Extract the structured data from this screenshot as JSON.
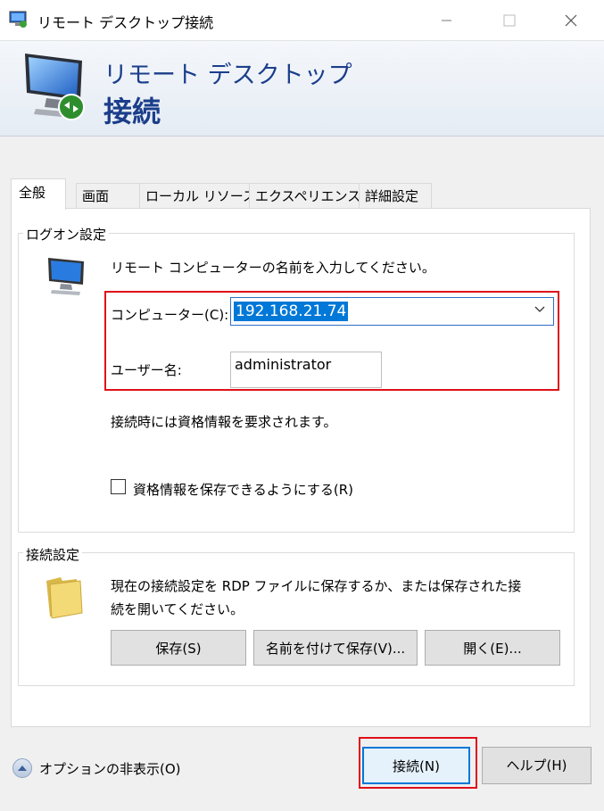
{
  "window": {
    "title": "リモート デスクトップ接続",
    "controls": {
      "minimize_icon": "minimize-icon",
      "maximize_icon": "maximize-icon",
      "close_icon": "close-icon"
    }
  },
  "banner": {
    "line1": "リモート デスクトップ",
    "line2": "接続",
    "icon": "remote-desktop-monitor-icon"
  },
  "tabs": [
    {
      "label": "全般",
      "active": true
    },
    {
      "label": "画面",
      "active": false
    },
    {
      "label": "ローカル リソース",
      "active": false
    },
    {
      "label": "エクスペリエンス",
      "active": false
    },
    {
      "label": "詳細設定",
      "active": false
    }
  ],
  "logon": {
    "group_label": "ログオン設定",
    "instruction": "リモート コンピューターの名前を入力してください。",
    "computer_label": "コンピューター(C):",
    "computer_value": "192.168.21.74",
    "username_label": "ユーザー名:",
    "username_value": "administrator",
    "credential_note": "接続時には資格情報を要求されます。",
    "save_credentials_label": "資格情報を保存できるようにする(R)",
    "save_credentials_checked": false
  },
  "connection": {
    "group_label": "接続設定",
    "description": "現在の接続設定を RDP ファイルに保存するか、または保存された接続を開いてください。",
    "description_line1": "現在の接続設定を RDP ファイルに保存するか、または保存された接",
    "description_line2": "続を開いてください。",
    "save_label": "保存(S)",
    "save_as_label": "名前を付けて保存(V)...",
    "open_label": "開く(E)..."
  },
  "footer": {
    "options_label": "オプションの非表示(O)",
    "connect_label": "接続(N)",
    "help_label": "ヘルプ(H)"
  },
  "colors": {
    "accent": "#0078d7",
    "highlight_border": "#e0101a",
    "banner_text": "#1b3e8b"
  }
}
